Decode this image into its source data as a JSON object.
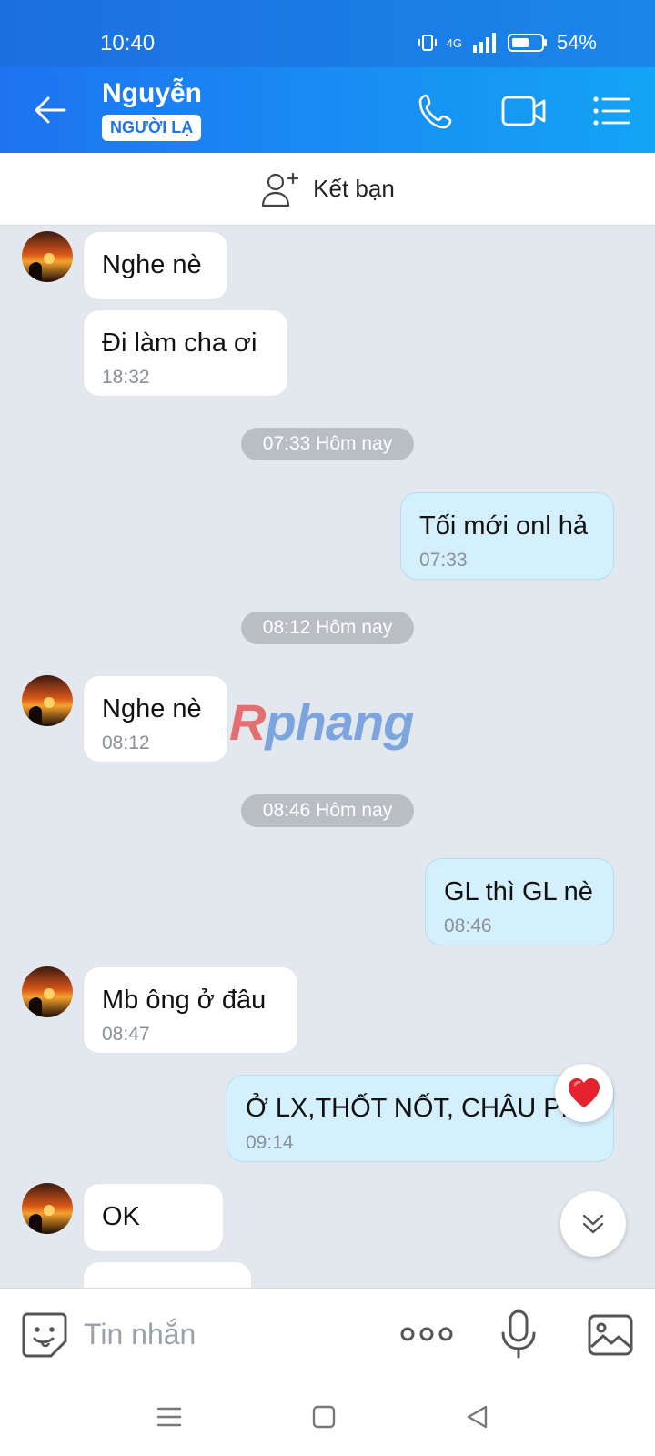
{
  "status_bar": {
    "time": "10:40",
    "network": "4G",
    "battery": "54%"
  },
  "header": {
    "contact_name": "Nguyễn",
    "badge": "NGƯỜI LẠ",
    "icons": [
      "back-arrow-icon",
      "phone-icon",
      "video-icon",
      "menu-list-icon"
    ]
  },
  "friend_bar": {
    "label": "Kết bạn",
    "icon": "add-person-icon"
  },
  "messages": [
    {
      "dir": "in",
      "text": "Nghe nè",
      "time": ""
    },
    {
      "dir": "in",
      "text": "Đi làm cha ơi",
      "time": "18:32"
    },
    {
      "dir": "out",
      "text": "Tối mới onl hả",
      "time": "07:33"
    },
    {
      "dir": "in",
      "text": "Nghe nè",
      "time": "08:12"
    },
    {
      "dir": "out",
      "text": "GL thì GL nè",
      "time": "08:46"
    },
    {
      "dir": "in",
      "text": "Mb ông ở đâu",
      "time": "08:47"
    },
    {
      "dir": "out",
      "text": "Ở LX,THỐT NỐT, CHÂU PHÚ",
      "time": "09:14"
    },
    {
      "dir": "in",
      "text": "OK",
      "time": ""
    }
  ],
  "dividers": [
    "07:33 Hôm nay",
    "08:12 Hôm nay",
    "08:46 Hôm nay"
  ],
  "watermark": {
    "first": "R",
    "rest": "phang"
  },
  "reaction": "heart-icon",
  "input": {
    "placeholder": "Tin nhắn"
  },
  "colors": {
    "header_start": "#1e73f1",
    "header_end": "#13a4f5",
    "outgoing_bubble": "#d5f0fd",
    "incoming_bubble": "#ffffff",
    "chat_bg": "#e2e8ee"
  }
}
